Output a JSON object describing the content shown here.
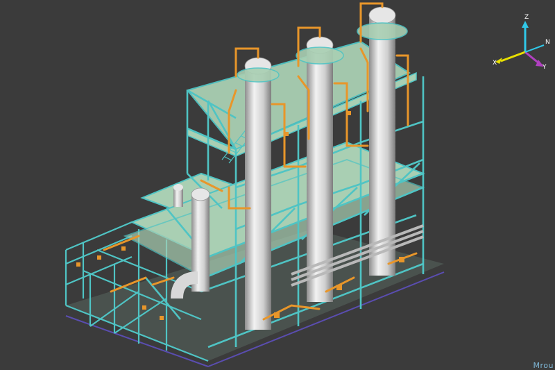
{
  "viewer": {
    "background": "#3b3b3b",
    "watermark": "Mrou"
  },
  "axes": {
    "x_label": "X",
    "y_label": "Y",
    "z_label": "Z",
    "n_label": "N",
    "x_color": "#e8e000",
    "y_color": "#b040c0",
    "z_color": "#30c8e8",
    "n_color": "#30c8e8"
  },
  "model": {
    "structure_color": "#4fc4c4",
    "deck_color": "#a9cfb3",
    "vessel_color": "#d8d8d8",
    "pipe_color": "#e8962a",
    "column_count": 3
  }
}
